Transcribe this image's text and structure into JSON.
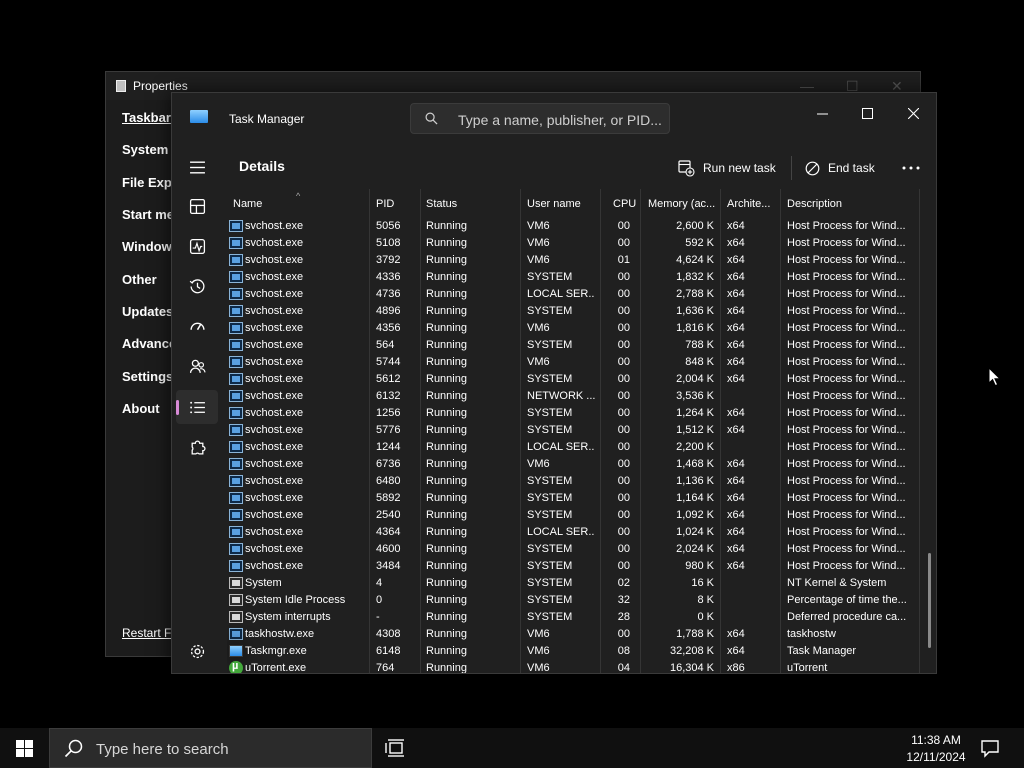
{
  "properties": {
    "title": "Properties",
    "nav": [
      "Taskbar",
      "System t",
      "File Expl",
      "Start me",
      "Window",
      "Other",
      "Updates",
      "Advance",
      "Settings",
      "About"
    ],
    "restart_link": "Restart Fil"
  },
  "task_manager": {
    "title": "Task Manager",
    "search_placeholder": "Type a name, publisher, or PID...",
    "panel_title": "Details",
    "run_new_task": "Run new task",
    "end_task": "End task",
    "columns": {
      "name": "Name",
      "pid": "PID",
      "status": "Status",
      "user": "User name",
      "cpu": "CPU",
      "memory": "Memory (ac...",
      "arch": "Archite...",
      "desc": "Description"
    },
    "rows": [
      {
        "icon": "svc",
        "name": "svchost.exe",
        "pid": "5056",
        "status": "Running",
        "user": "VM6",
        "cpu": "00",
        "mem": "2,600 K",
        "arch": "x64",
        "desc": "Host Process for Wind..."
      },
      {
        "icon": "svc",
        "name": "svchost.exe",
        "pid": "5108",
        "status": "Running",
        "user": "VM6",
        "cpu": "00",
        "mem": "592 K",
        "arch": "x64",
        "desc": "Host Process for Wind..."
      },
      {
        "icon": "svc",
        "name": "svchost.exe",
        "pid": "3792",
        "status": "Running",
        "user": "VM6",
        "cpu": "01",
        "mem": "4,624 K",
        "arch": "x64",
        "desc": "Host Process for Wind..."
      },
      {
        "icon": "svc",
        "name": "svchost.exe",
        "pid": "4336",
        "status": "Running",
        "user": "SYSTEM",
        "cpu": "00",
        "mem": "1,832 K",
        "arch": "x64",
        "desc": "Host Process for Wind..."
      },
      {
        "icon": "svc",
        "name": "svchost.exe",
        "pid": "4736",
        "status": "Running",
        "user": "LOCAL SER...",
        "cpu": "00",
        "mem": "2,788 K",
        "arch": "x64",
        "desc": "Host Process for Wind..."
      },
      {
        "icon": "svc",
        "name": "svchost.exe",
        "pid": "4896",
        "status": "Running",
        "user": "SYSTEM",
        "cpu": "00",
        "mem": "1,636 K",
        "arch": "x64",
        "desc": "Host Process for Wind..."
      },
      {
        "icon": "svc",
        "name": "svchost.exe",
        "pid": "4356",
        "status": "Running",
        "user": "VM6",
        "cpu": "00",
        "mem": "1,816 K",
        "arch": "x64",
        "desc": "Host Process for Wind..."
      },
      {
        "icon": "svc",
        "name": "svchost.exe",
        "pid": "564",
        "status": "Running",
        "user": "SYSTEM",
        "cpu": "00",
        "mem": "788 K",
        "arch": "x64",
        "desc": "Host Process for Wind..."
      },
      {
        "icon": "svc",
        "name": "svchost.exe",
        "pid": "5744",
        "status": "Running",
        "user": "VM6",
        "cpu": "00",
        "mem": "848 K",
        "arch": "x64",
        "desc": "Host Process for Wind..."
      },
      {
        "icon": "svc",
        "name": "svchost.exe",
        "pid": "5612",
        "status": "Running",
        "user": "SYSTEM",
        "cpu": "00",
        "mem": "2,004 K",
        "arch": "x64",
        "desc": "Host Process for Wind..."
      },
      {
        "icon": "svc",
        "name": "svchost.exe",
        "pid": "6132",
        "status": "Running",
        "user": "NETWORK ...",
        "cpu": "00",
        "mem": "3,536 K",
        "arch": "",
        "desc": "Host Process for Wind..."
      },
      {
        "icon": "svc",
        "name": "svchost.exe",
        "pid": "1256",
        "status": "Running",
        "user": "SYSTEM",
        "cpu": "00",
        "mem": "1,264 K",
        "arch": "x64",
        "desc": "Host Process for Wind..."
      },
      {
        "icon": "svc",
        "name": "svchost.exe",
        "pid": "5776",
        "status": "Running",
        "user": "SYSTEM",
        "cpu": "00",
        "mem": "1,512 K",
        "arch": "x64",
        "desc": "Host Process for Wind..."
      },
      {
        "icon": "svc",
        "name": "svchost.exe",
        "pid": "1244",
        "status": "Running",
        "user": "LOCAL SER...",
        "cpu": "00",
        "mem": "2,200 K",
        "arch": "",
        "desc": "Host Process for Wind..."
      },
      {
        "icon": "svc",
        "name": "svchost.exe",
        "pid": "6736",
        "status": "Running",
        "user": "VM6",
        "cpu": "00",
        "mem": "1,468 K",
        "arch": "x64",
        "desc": "Host Process for Wind..."
      },
      {
        "icon": "svc",
        "name": "svchost.exe",
        "pid": "6480",
        "status": "Running",
        "user": "SYSTEM",
        "cpu": "00",
        "mem": "1,136 K",
        "arch": "x64",
        "desc": "Host Process for Wind..."
      },
      {
        "icon": "svc",
        "name": "svchost.exe",
        "pid": "5892",
        "status": "Running",
        "user": "SYSTEM",
        "cpu": "00",
        "mem": "1,164 K",
        "arch": "x64",
        "desc": "Host Process for Wind..."
      },
      {
        "icon": "svc",
        "name": "svchost.exe",
        "pid": "2540",
        "status": "Running",
        "user": "SYSTEM",
        "cpu": "00",
        "mem": "1,092 K",
        "arch": "x64",
        "desc": "Host Process for Wind..."
      },
      {
        "icon": "svc",
        "name": "svchost.exe",
        "pid": "4364",
        "status": "Running",
        "user": "LOCAL SER...",
        "cpu": "00",
        "mem": "1,024 K",
        "arch": "x64",
        "desc": "Host Process for Wind..."
      },
      {
        "icon": "svc",
        "name": "svchost.exe",
        "pid": "4600",
        "status": "Running",
        "user": "SYSTEM",
        "cpu": "00",
        "mem": "2,024 K",
        "arch": "x64",
        "desc": "Host Process for Wind..."
      },
      {
        "icon": "svc",
        "name": "svchost.exe",
        "pid": "3484",
        "status": "Running",
        "user": "SYSTEM",
        "cpu": "00",
        "mem": "980 K",
        "arch": "x64",
        "desc": "Host Process for Wind..."
      },
      {
        "icon": "sys",
        "name": "System",
        "pid": "4",
        "status": "Running",
        "user": "SYSTEM",
        "cpu": "02",
        "mem": "16 K",
        "arch": "",
        "desc": "NT Kernel & System"
      },
      {
        "icon": "sys",
        "name": "System Idle Process",
        "pid": "0",
        "status": "Running",
        "user": "SYSTEM",
        "cpu": "32",
        "mem": "8 K",
        "arch": "",
        "desc": "Percentage of time the..."
      },
      {
        "icon": "sys",
        "name": "System interrupts",
        "pid": "-",
        "status": "Running",
        "user": "SYSTEM",
        "cpu": "28",
        "mem": "0 K",
        "arch": "",
        "desc": "Deferred procedure ca..."
      },
      {
        "icon": "svc",
        "name": "taskhostw.exe",
        "pid": "4308",
        "status": "Running",
        "user": "VM6",
        "cpu": "00",
        "mem": "1,788 K",
        "arch": "x64",
        "desc": "taskhostw"
      },
      {
        "icon": "tm",
        "name": "Taskmgr.exe",
        "pid": "6148",
        "status": "Running",
        "user": "VM6",
        "cpu": "08",
        "mem": "32,208 K",
        "arch": "x64",
        "desc": "Task Manager"
      },
      {
        "icon": "ut",
        "name": "uTorrent.exe",
        "pid": "764",
        "status": "Running",
        "user": "VM6",
        "cpu": "04",
        "mem": "16,304 K",
        "arch": "x86",
        "desc": "uTorrent"
      }
    ]
  },
  "taskbar": {
    "search_placeholder": "Type here to search",
    "time": "11:38 AM",
    "date": "12/11/2024"
  },
  "icons": {
    "start": "windows-logo-icon",
    "search": "search-icon",
    "task_view": "task-view-icon",
    "notifications": "notification-icon"
  },
  "colors": {
    "accent": "#d88ad6",
    "window_bg": "#202020"
  }
}
